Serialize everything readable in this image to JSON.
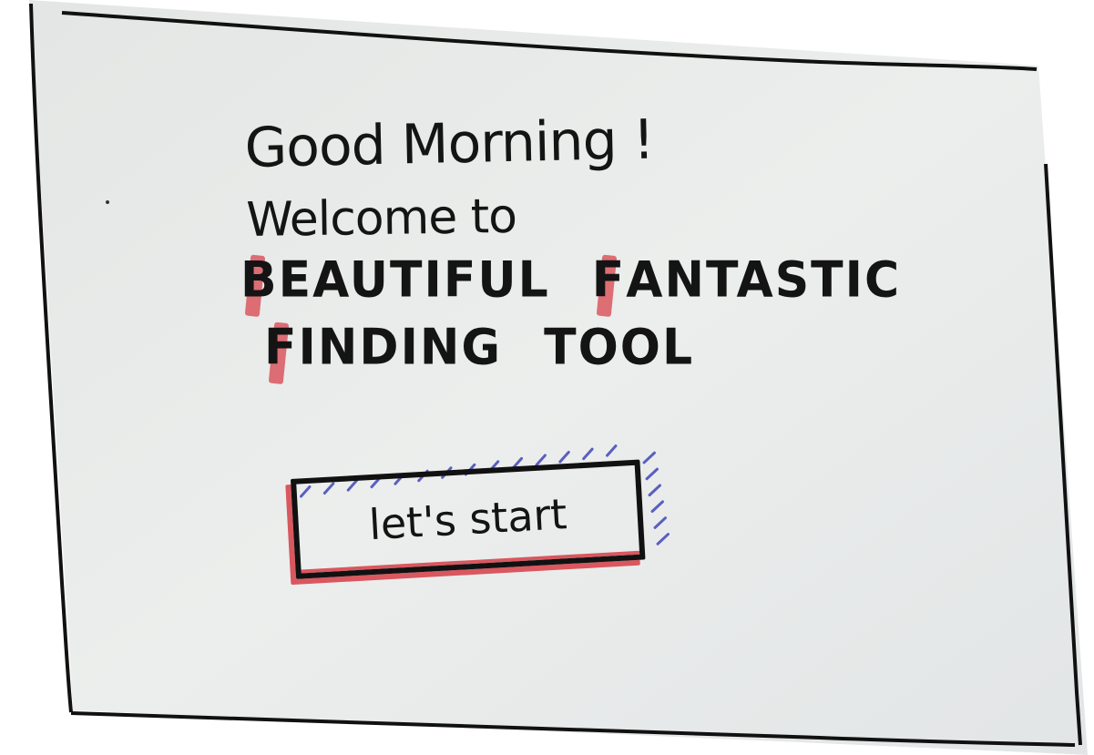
{
  "greeting": {
    "line1": "Good Morning !",
    "line2": "Welcome to"
  },
  "app_name": {
    "words": [
      {
        "initial": "B",
        "rest": "EAUTIFUL"
      },
      {
        "initial": "F",
        "rest": "ANTASTIC"
      },
      {
        "initial": "F",
        "rest": "INDING"
      },
      {
        "initial": "",
        "rest": "TOOL"
      }
    ]
  },
  "start_button": {
    "label": "let's start"
  },
  "colors": {
    "paper": "#e9ebea",
    "ink": "#141414",
    "accent_red": "#d9575f",
    "hatch_blue": "#5a5fc0"
  }
}
